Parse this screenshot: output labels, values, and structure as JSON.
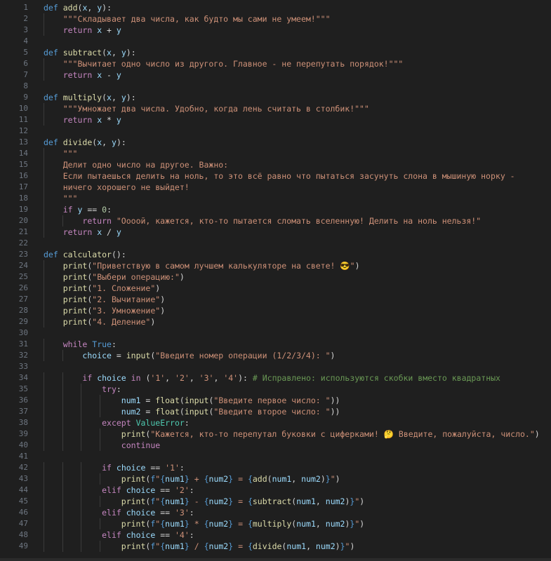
{
  "editor": {
    "language": "python",
    "lines": [
      {
        "n": "1",
        "code": "def add(x, y):"
      },
      {
        "n": "2",
        "code": "    \"\"\"Складывает два числа, как будто мы сами не умеем!\"\"\""
      },
      {
        "n": "3",
        "code": "    return x + y"
      },
      {
        "n": "4",
        "code": ""
      },
      {
        "n": "5",
        "code": "def subtract(x, y):"
      },
      {
        "n": "6",
        "code": "    \"\"\"Вычитает одно число из другого. Главное - не перепутать порядок!\"\"\""
      },
      {
        "n": "7",
        "code": "    return x - y"
      },
      {
        "n": "8",
        "code": ""
      },
      {
        "n": "9",
        "code": "def multiply(x, y):"
      },
      {
        "n": "10",
        "code": "    \"\"\"Умножает два числа. Удобно, когда лень считать в столбик!\"\"\""
      },
      {
        "n": "11",
        "code": "    return x * y"
      },
      {
        "n": "12",
        "code": ""
      },
      {
        "n": "13",
        "code": "def divide(x, y):"
      },
      {
        "n": "14",
        "code": "    \"\"\""
      },
      {
        "n": "15",
        "code": "    Делит одно число на другое. Важно:"
      },
      {
        "n": "16",
        "code": "    Если пытаешься делить на ноль, то это всё равно что пытаться засунуть слона в мышиную норку -"
      },
      {
        "n": "17",
        "code": "    ничего хорошего не выйдет!"
      },
      {
        "n": "18",
        "code": "    \"\"\""
      },
      {
        "n": "19",
        "code": "    if y == 0:"
      },
      {
        "n": "20",
        "code": "        return \"Оооой, кажется, кто-то пытается сломать вселенную! Делить на ноль нельзя!\""
      },
      {
        "n": "21",
        "code": "    return x / y"
      },
      {
        "n": "22",
        "code": ""
      },
      {
        "n": "23",
        "code": "def calculator():"
      },
      {
        "n": "24",
        "code": "    print(\"Приветствую в самом лучшем калькуляторе на свете! 😎\")"
      },
      {
        "n": "25",
        "code": "    print(\"Выбери операцию:\")"
      },
      {
        "n": "26",
        "code": "    print(\"1. Сложение\")"
      },
      {
        "n": "27",
        "code": "    print(\"2. Вычитание\")"
      },
      {
        "n": "28",
        "code": "    print(\"3. Умножение\")"
      },
      {
        "n": "29",
        "code": "    print(\"4. Деление\")"
      },
      {
        "n": "30",
        "code": ""
      },
      {
        "n": "31",
        "code": "    while True:"
      },
      {
        "n": "32",
        "code": "        choice = input(\"Введите номер операции (1/2/3/4): \")"
      },
      {
        "n": "33",
        "code": ""
      },
      {
        "n": "34",
        "code": "        if choice in ('1', '2', '3', '4'): # Исправлено: используются скобки вместо квадратных"
      },
      {
        "n": "35",
        "code": "            try:"
      },
      {
        "n": "36",
        "code": "                num1 = float(input(\"Введите первое число: \"))"
      },
      {
        "n": "37",
        "code": "                num2 = float(input(\"Введите второе число: \"))"
      },
      {
        "n": "38",
        "code": "            except ValueError:"
      },
      {
        "n": "39",
        "code": "                print(\"Кажется, кто-то перепутал буковки с циферками! 🤔 Введите, пожалуйста, число.\")"
      },
      {
        "n": "40",
        "code": "                continue"
      },
      {
        "n": "41",
        "code": ""
      },
      {
        "n": "42",
        "code": "            if choice == '1':"
      },
      {
        "n": "43",
        "code": "                print(f\"{num1} + {num2} = {add(num1, num2)}\")"
      },
      {
        "n": "44",
        "code": "            elif choice == '2':"
      },
      {
        "n": "45",
        "code": "                print(f\"{num1} - {num2} = {subtract(num1, num2)}\")"
      },
      {
        "n": "46",
        "code": "            elif choice == '3':"
      },
      {
        "n": "47",
        "code": "                print(f\"{num1} * {num2} = {multiply(num1, num2)}\")"
      },
      {
        "n": "48",
        "code": "            elif choice == '4':"
      },
      {
        "n": "49",
        "code": "                print(f\"{num1} / {num2} = {divide(num1, num2)}\")"
      }
    ]
  },
  "colors": {
    "background": "#1f1f1f",
    "line_number": "#6e7681",
    "keyword": "#569cd6",
    "control": "#c586c0",
    "function": "#dcdcaa",
    "string": "#ce9178",
    "variable": "#9cdcfe",
    "number": "#b5cea8",
    "comment": "#6a9955",
    "type": "#4ec9b0"
  }
}
